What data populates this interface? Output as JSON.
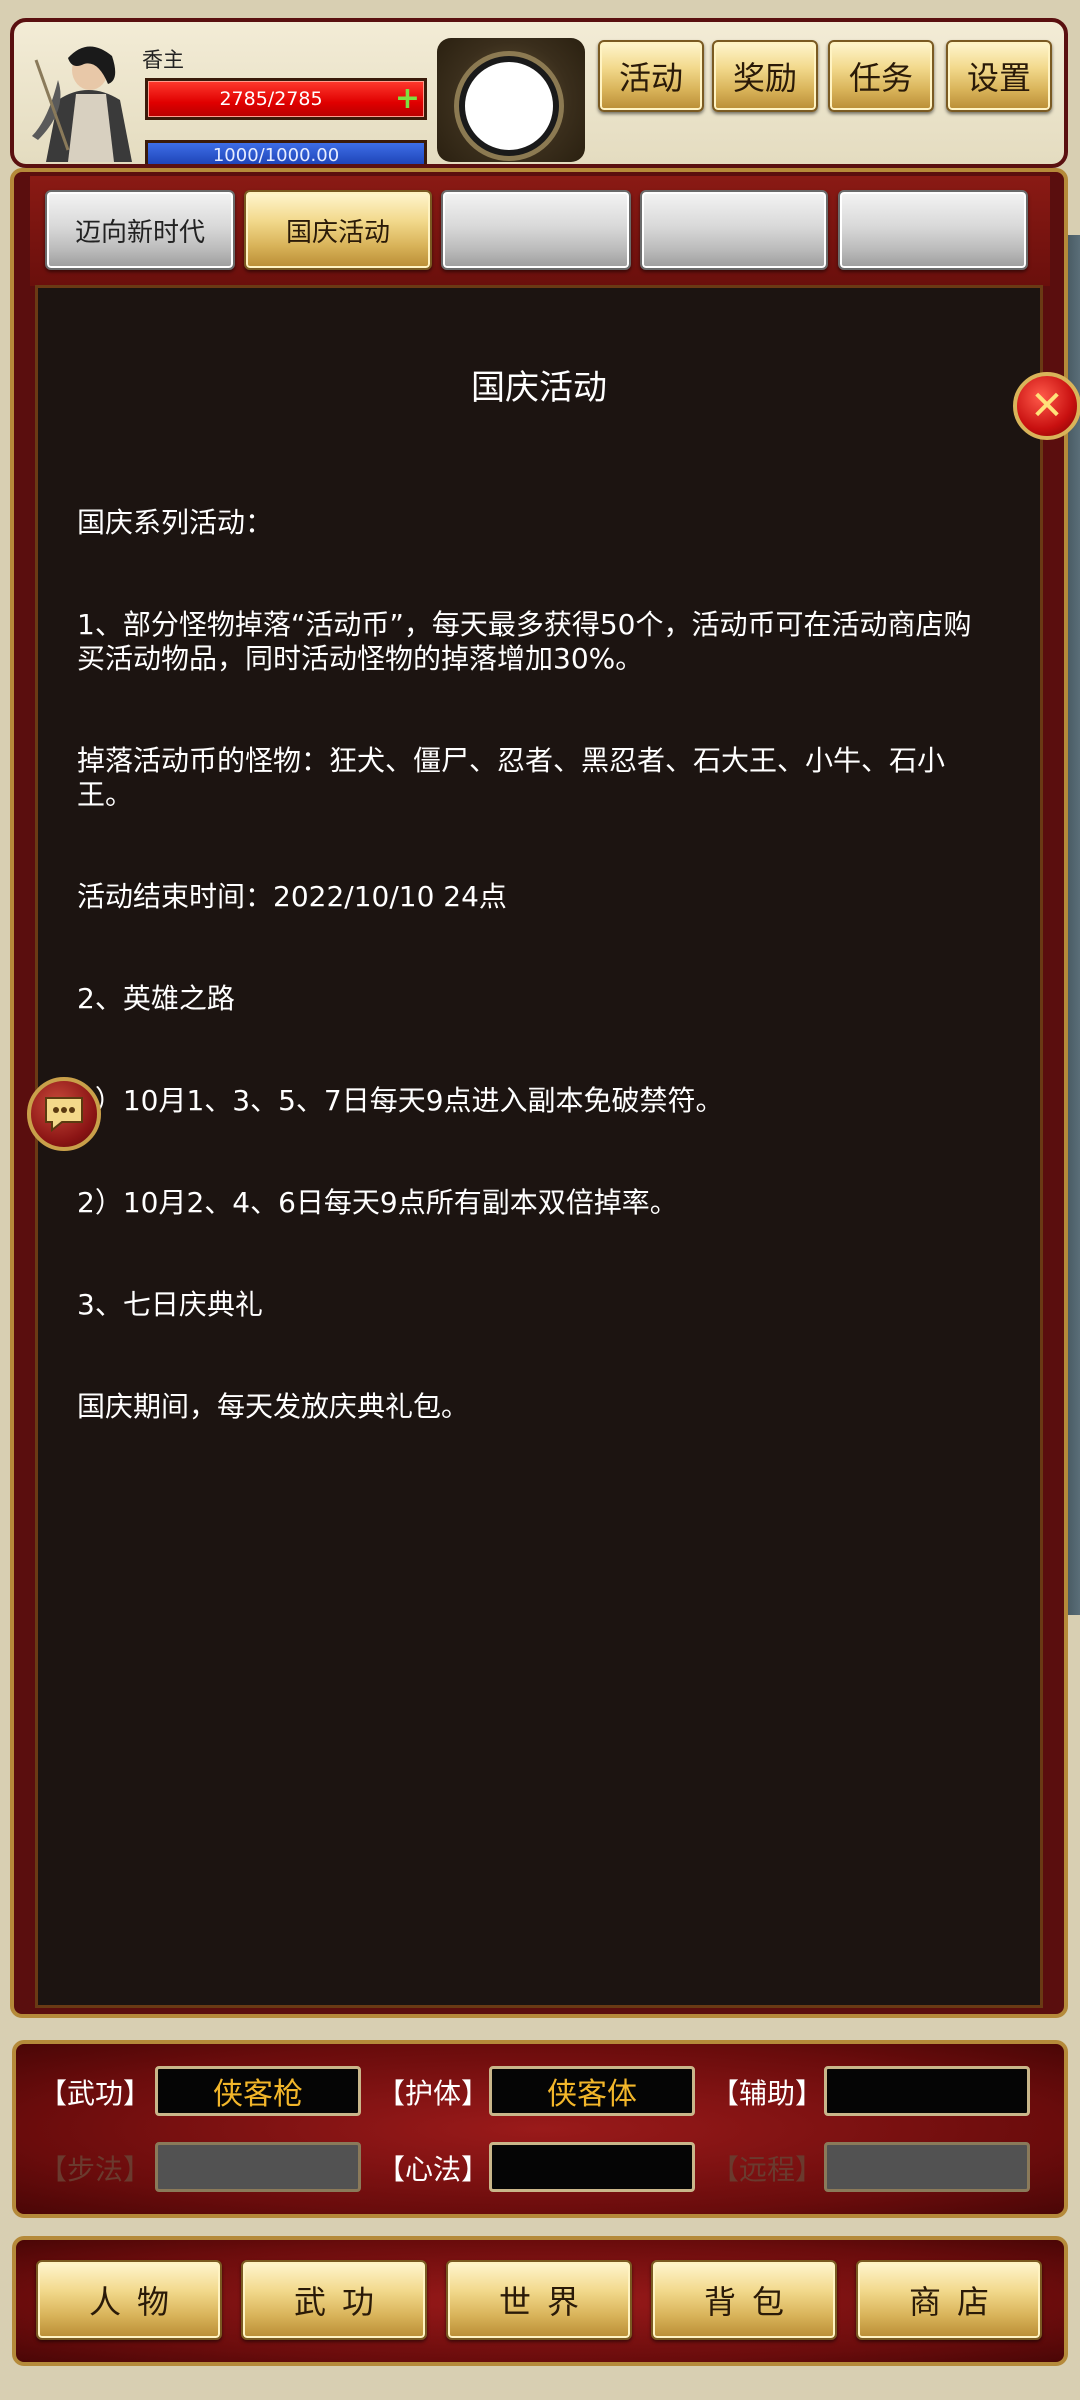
{
  "player": {
    "name": "香主",
    "hp": "2785/2785",
    "hp_add": "+",
    "mp": "1000/1000.00"
  },
  "top_menu": [
    {
      "label": "活动"
    },
    {
      "label": "奖励"
    },
    {
      "label": "任务"
    },
    {
      "label": "设置"
    }
  ],
  "tabs": [
    {
      "label": "迈向新时代",
      "active": false
    },
    {
      "label": "国庆活动",
      "active": true
    },
    {
      "label": "",
      "active": false
    },
    {
      "label": "",
      "active": false
    },
    {
      "label": "",
      "active": false
    }
  ],
  "content": {
    "title": "国庆活动",
    "lines": [
      "国庆系列活动：",
      "1、部分怪物掉落“活动币”，每天最多获得50个，活动币可在活动商店购买活动物品，同时活动怪物的掉落增加30%。",
      "掉落活动币的怪物：狂犬、僵尸、忍者、黑忍者、石大王、小牛、石小王。",
      "活动结束时间：2022/10/10 24点",
      "2、英雄之路",
      "1）10月1、3、5、7日每天9点进入副本免破禁符。",
      "2）10月2、4、6日每天9点所有副本双倍掉率。",
      "3、七日庆典礼",
      "国庆期间，每天发放庆典礼包。"
    ]
  },
  "close_icon": "close-icon",
  "chat_icon": "chat-icon",
  "equipment": {
    "wugong": {
      "label": "【武功】",
      "value": "侠客枪"
    },
    "huti": {
      "label": "【护体】",
      "value": "侠客体"
    },
    "fuzhu": {
      "label": "【辅助】",
      "value": ""
    },
    "bufa": {
      "label": "【步法】",
      "value": ""
    },
    "xinfa": {
      "label": "【心法】",
      "value": ""
    },
    "yuancheng": {
      "label": "【远程】",
      "value": ""
    }
  },
  "bottom_nav": [
    {
      "label": "人物"
    },
    {
      "label": "武功"
    },
    {
      "label": "世界"
    },
    {
      "label": "背包"
    },
    {
      "label": "商店"
    }
  ],
  "colors": {
    "frame_red": "#5a0e0e",
    "gold": "#d9b45a",
    "content_bg": "#1c1411",
    "equip_value": "#f2b62a"
  }
}
